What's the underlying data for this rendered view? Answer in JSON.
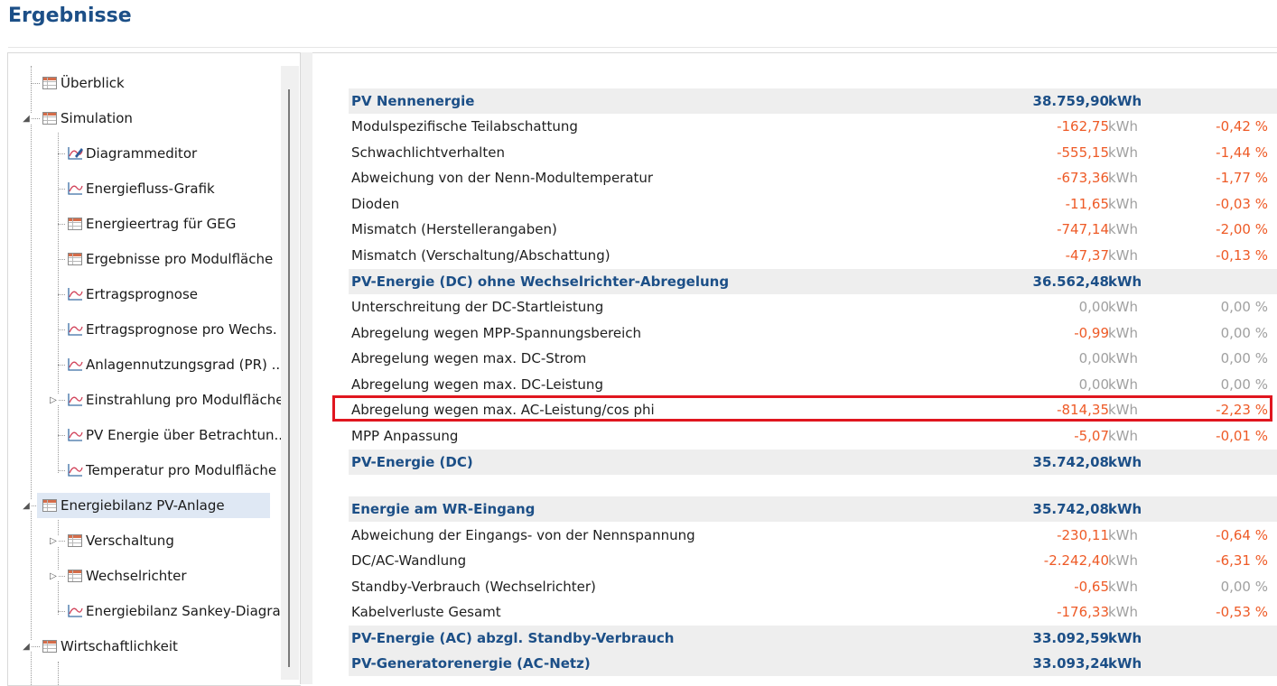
{
  "page": {
    "title": "Ergebnisse"
  },
  "tree": {
    "items": [
      {
        "label": "Überblick",
        "icon": "table-icon"
      },
      {
        "label": "Simulation",
        "icon": "table-icon"
      },
      {
        "label": "Diagrammeditor",
        "icon": "chart-edit-icon"
      },
      {
        "label": "Energiefluss-Grafik",
        "icon": "chart-line-icon"
      },
      {
        "label": "Energieertrag für GEG",
        "icon": "table-icon"
      },
      {
        "label": "Ergebnisse pro Modulfläche",
        "icon": "table-icon"
      },
      {
        "label": "Ertragsprognose",
        "icon": "chart-line-icon"
      },
      {
        "label": "Ertragsprognose pro Wechs.",
        "icon": "chart-line-icon"
      },
      {
        "label": "Anlagennutzungsgrad (PR) ..",
        "icon": "chart-line-icon"
      },
      {
        "label": "Einstrahlung pro Modulfläche",
        "icon": "chart-line-icon"
      },
      {
        "label": "PV Energie über Betrachtun..",
        "icon": "chart-line-icon"
      },
      {
        "label": "Temperatur pro Modulfläche",
        "icon": "chart-line-icon"
      },
      {
        "label": "Energiebilanz PV-Anlage",
        "icon": "table-icon",
        "selected": true
      },
      {
        "label": "Verschaltung",
        "icon": "table-icon"
      },
      {
        "label": "Wechselrichter",
        "icon": "table-icon"
      },
      {
        "label": "Energiebilanz Sankey-Diagra.",
        "icon": "chart-line-icon"
      },
      {
        "label": "Wirtschaftlichkeit",
        "icon": "table-icon"
      }
    ]
  },
  "results": {
    "rows": [
      {
        "label": "PV Nennenergie",
        "value": "38.759,90",
        "unit": "kWh",
        "pct": "",
        "header": true
      },
      {
        "label": "Modulspezifische Teilabschattung",
        "value": "-162,75",
        "unit": "kWh",
        "pct": "-0,42 %"
      },
      {
        "label": "Schwachlichtverhalten",
        "value": "-555,15",
        "unit": "kWh",
        "pct": "-1,44 %"
      },
      {
        "label": "Abweichung von der Nenn-Modultemperatur",
        "value": "-673,36",
        "unit": "kWh",
        "pct": "-1,77 %"
      },
      {
        "label": "Dioden",
        "value": "-11,65",
        "unit": "kWh",
        "pct": "-0,03 %"
      },
      {
        "label": "Mismatch (Herstellerangaben)",
        "value": "-747,14",
        "unit": "kWh",
        "pct": "-2,00 %"
      },
      {
        "label": "Mismatch (Verschaltung/Abschattung)",
        "value": "-47,37",
        "unit": "kWh",
        "pct": "-0,13 %"
      },
      {
        "label": "PV-Energie (DC) ohne Wechselrichter-Abregelung",
        "value": "36.562,48",
        "unit": "kWh",
        "pct": "",
        "header": true
      },
      {
        "label": "Unterschreitung der DC-Startleistung",
        "value": "0,00",
        "unit": "kWh",
        "pct": "0,00 %",
        "zero": true
      },
      {
        "label": "Abregelung wegen MPP-Spannungsbereich",
        "value": "-0,99",
        "unit": "kWh",
        "pct": "0,00 %",
        "pctZero": true
      },
      {
        "label": "Abregelung wegen max. DC-Strom",
        "value": "0,00",
        "unit": "kWh",
        "pct": "0,00 %",
        "zero": true
      },
      {
        "label": "Abregelung wegen max. DC-Leistung",
        "value": "0,00",
        "unit": "kWh",
        "pct": "0,00 %",
        "zero": true
      },
      {
        "label": "Abregelung wegen max. AC-Leistung/cos phi",
        "value": "-814,35",
        "unit": "kWh",
        "pct": "-2,23 %"
      },
      {
        "label": "MPP Anpassung",
        "value": "-5,07",
        "unit": "kWh",
        "pct": "-0,01 %"
      },
      {
        "label": "PV-Energie (DC)",
        "value": "35.742,08",
        "unit": "kWh",
        "pct": "",
        "header": true
      },
      {
        "label": "Energie am WR-Eingang",
        "value": "35.742,08",
        "unit": "kWh",
        "pct": "",
        "header": true
      },
      {
        "label": "Abweichung der Eingangs- von der Nennspannung",
        "value": "-230,11",
        "unit": "kWh",
        "pct": "-0,64 %"
      },
      {
        "label": "DC/AC-Wandlung",
        "value": "-2.242,40",
        "unit": "kWh",
        "pct": "-6,31 %"
      },
      {
        "label": "Standby-Verbrauch (Wechselrichter)",
        "value": "-0,65",
        "unit": "kWh",
        "pct": "0,00 %",
        "pctZero": true
      },
      {
        "label": "Kabelverluste Gesamt",
        "value": "-176,33",
        "unit": "kWh",
        "pct": "-0,53 %"
      },
      {
        "label": "PV-Energie (AC) abzgl. Standby-Verbrauch",
        "value": "33.092,59",
        "unit": "kWh",
        "pct": "",
        "header": true
      },
      {
        "label": "PV-Generatorenergie (AC-Netz)",
        "value": "33.093,24",
        "unit": "kWh",
        "pct": "",
        "header": true
      }
    ]
  },
  "colors": {
    "header_text": "#1c4f87",
    "negative": "#ee5a26",
    "zero": "#a0a0a0",
    "highlight": "#e0161f",
    "selected_bg": "#dfe8f4"
  }
}
